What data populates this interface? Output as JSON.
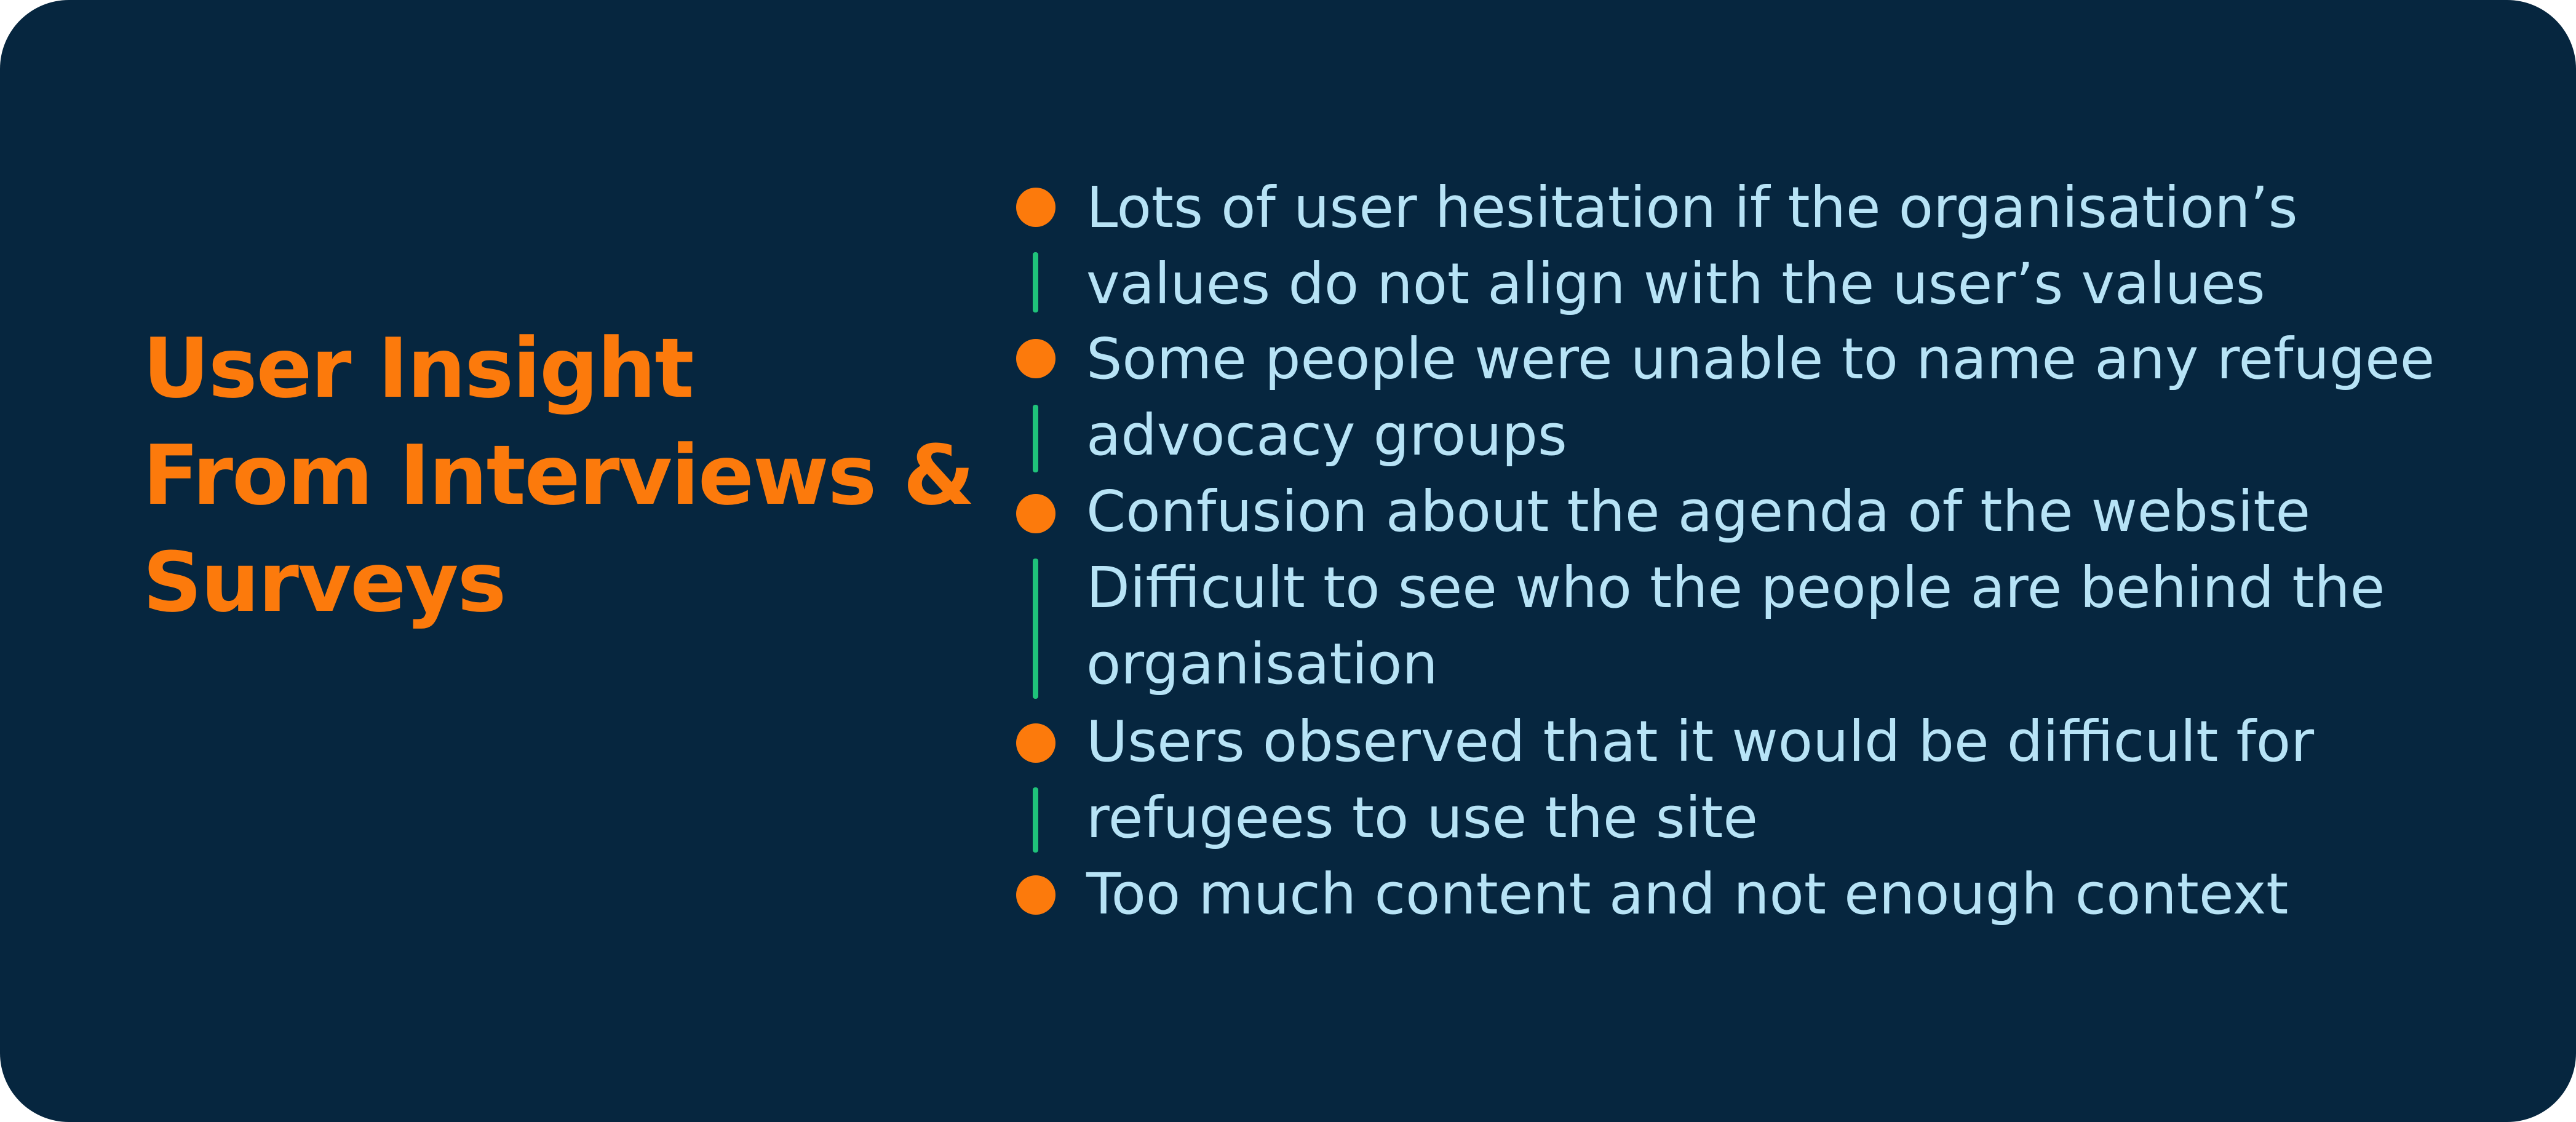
{
  "heading": {
    "line1": "User Insight",
    "line2": "From Interviews &",
    "line3": "Surveys"
  },
  "insights": [
    {
      "line1": "Lots of user hesitation if the organisation’s",
      "line2": "values do not align with the user’s values"
    },
    {
      "line1": "Some people were unable to name any refugee",
      "line2": "advocacy groups"
    },
    {
      "line1": "Confusion about the agenda of the website"
    },
    {
      "line1": "Difficult to see who the people are behind the",
      "line2": "organisation"
    },
    {
      "line1": "Users observed that it would be difficult for",
      "line2": "refugees to use the site"
    },
    {
      "line1": "Too much content and not enough context"
    }
  ],
  "colors": {
    "background": "#06263f",
    "heading": "#fc7a0c",
    "bullet": "#fc7a0c",
    "connector": "#1fc27a",
    "text": "#b7e3f6"
  }
}
